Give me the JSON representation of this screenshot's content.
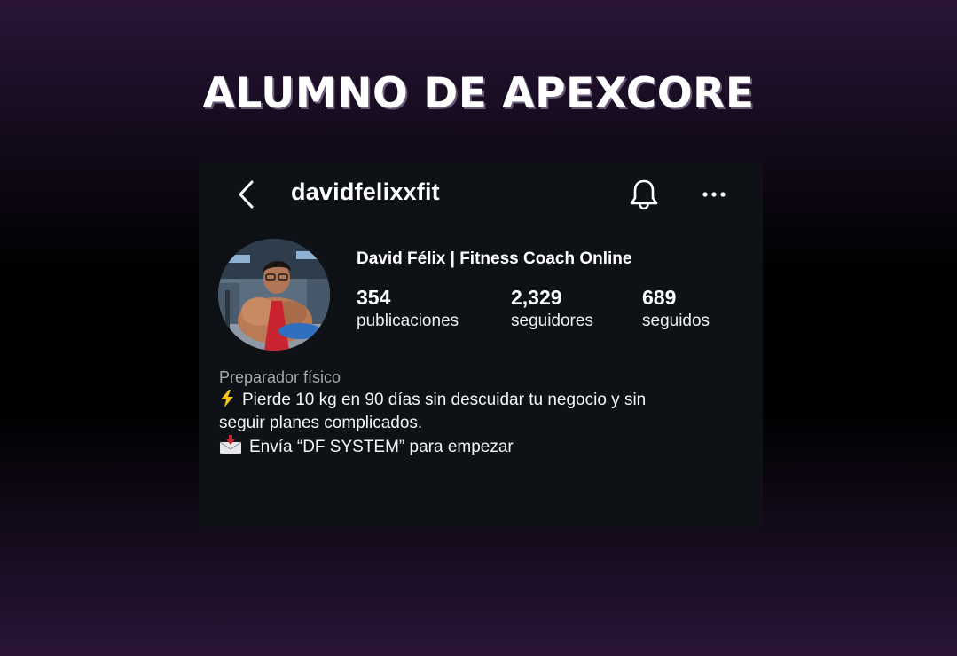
{
  "headline": "ALUMNO DE APEXCORE",
  "profile": {
    "username": "davidfelixxfit",
    "full_name": "David Félix | Fitness Coach Online",
    "stats": [
      {
        "count": "354",
        "label": "publicaciones"
      },
      {
        "count": "2,329",
        "label": "seguidores"
      },
      {
        "count": "689",
        "label": "seguidos"
      }
    ],
    "category": "Preparador físico",
    "bio_line_1": "Pierde 10 kg en 90 días sin descuidar tu negocio y sin",
    "bio_line_2": "seguir planes complicados.",
    "bio_line_3": "Envía “DF SYSTEM” para empezar"
  },
  "icons": {
    "back": "chevron-left-icon",
    "bell": "bell-icon",
    "more": "more-dots-icon",
    "bolt": "lightning-emoji",
    "inbox": "envelope-arrow-emoji"
  },
  "colors": {
    "card_bg": "#0e1216",
    "background_glow": "#2a1537",
    "bolt": "#f5c518"
  }
}
